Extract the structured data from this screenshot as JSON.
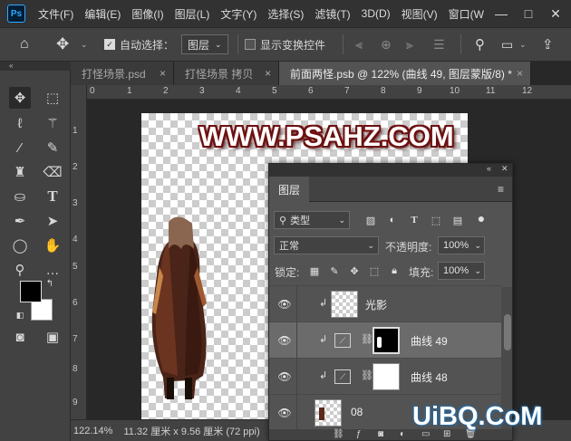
{
  "app": {
    "logo": "Ps"
  },
  "menu": [
    "文件(F)",
    "编辑(E)",
    "图像(I)",
    "图层(L)",
    "文字(Y)",
    "选择(S)",
    "滤镜(T)",
    "3D(D)",
    "视图(V)",
    "窗口(W"
  ],
  "window_controls": {
    "minimize": "—",
    "maximize": "□",
    "close": "✕"
  },
  "options": {
    "auto_select_label": "自动选择：",
    "auto_select_checked": true,
    "auto_select_target": "图层",
    "show_transform_label": "显示变换控件",
    "show_transform_checked": false
  },
  "tabs": [
    {
      "label": "打怪场景.psd",
      "close": "×",
      "active": false
    },
    {
      "label": "打怪场景 拷贝",
      "close": "×",
      "active": false
    },
    {
      "label": "前面两怪.psb @ 122% (曲线 49, 图层蒙版/8) *",
      "close": "×",
      "active": true
    }
  ],
  "ruler": {
    "top": [
      "0",
      "1",
      "2",
      "3",
      "4",
      "5",
      "6",
      "7",
      "8",
      "9",
      "10",
      "11",
      "12"
    ],
    "left": [
      "1",
      "2",
      "3",
      "4",
      "5",
      "6",
      "7",
      "8",
      "9"
    ]
  },
  "canvas": {
    "watermark": "WWW.PSAHZ.COM"
  },
  "status": {
    "zoom": "122.14%",
    "doc_size": "11.32 厘米 x 9.56 厘米 (72 ppi)"
  },
  "layers_panel": {
    "title": "图层",
    "filter_kind": "类型",
    "blend_mode": "正常",
    "opacity_label": "不透明度:",
    "opacity_value": "100%",
    "lock_label": "锁定:",
    "fill_label": "填充:",
    "fill_value": "100%",
    "layers": [
      {
        "name": "光影",
        "type": "pixel",
        "visible": true,
        "clipped": true,
        "selected": false
      },
      {
        "name": "曲线 49",
        "type": "curves",
        "visible": true,
        "clipped": true,
        "selected": true
      },
      {
        "name": "曲线 48",
        "type": "curves",
        "visible": true,
        "clipped": true,
        "selected": false
      },
      {
        "name": "08",
        "type": "smart-object",
        "visible": true,
        "clipped": false,
        "selected": false
      }
    ]
  },
  "overlay_logo": "UiBQ.CoM",
  "colors": {
    "foreground": "#000000",
    "background": "#ffffff",
    "watermark_outline": "#6e1010"
  }
}
